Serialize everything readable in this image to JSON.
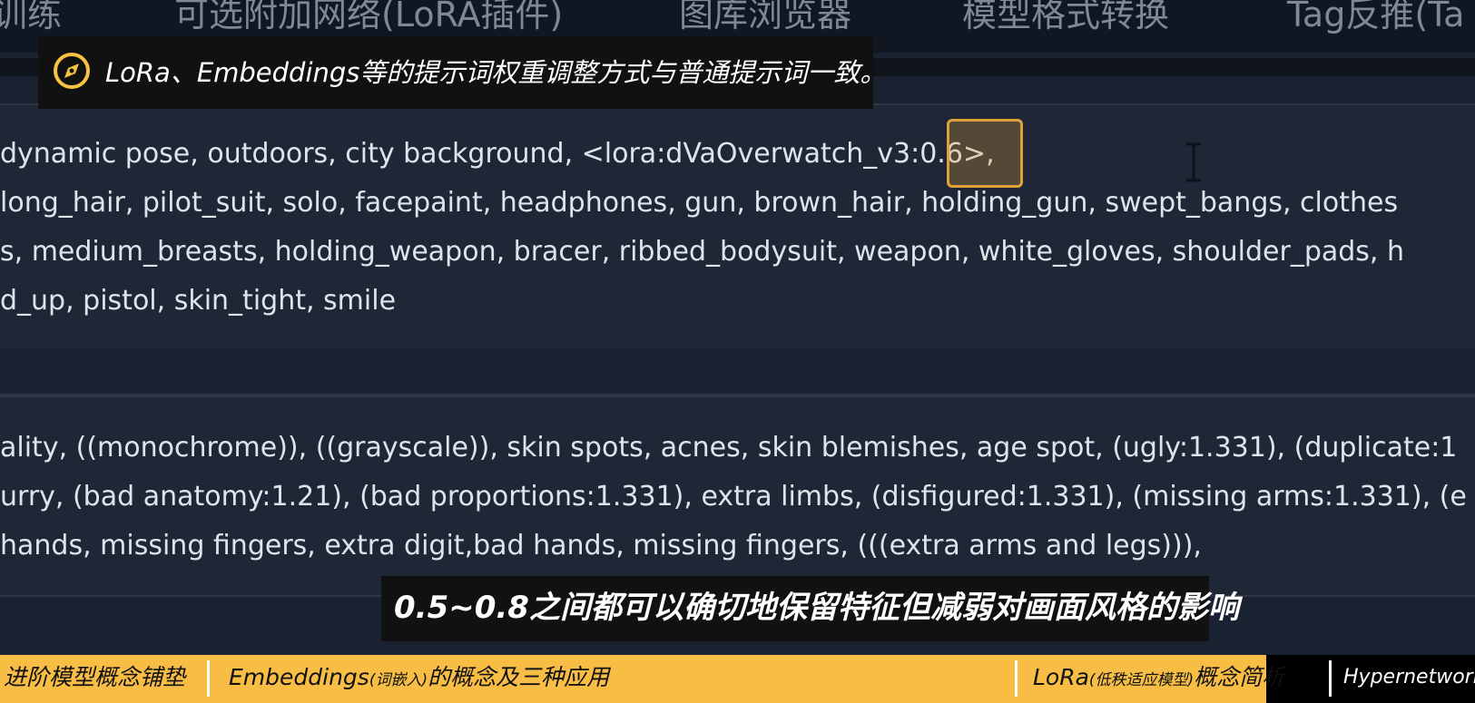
{
  "tabs": [
    {
      "label": "训练"
    },
    {
      "label": "可选附加网络(LoRA插件)"
    },
    {
      "label": "图库浏览器"
    },
    {
      "label": "模型格式转换"
    },
    {
      "label": "Tag反推(Ta"
    }
  ],
  "tip": {
    "icon": "compass-icon",
    "text": "LoRa、Embeddings等的提示词权重调整方式与普通提示词一致。",
    "color": "#f5c242"
  },
  "positive_prompt": {
    "lines": [
      " dynamic pose, outdoors, city background, <lora:dVaOverwatch_v3:0.6>,",
      " long_hair, pilot_suit, solo, facepaint, headphones, gun, brown_hair, holding_gun, swept_bangs, clothes",
      "s, medium_breasts, holding_weapon, bracer, ribbed_bodysuit, weapon, white_gloves, shoulder_pads, h",
      "d_up, pistol, skin_tight, smile"
    ]
  },
  "negative_prompt": {
    "lines": [
      "ality, ((monochrome)), ((grayscale)), skin spots, acnes, skin blemishes, age spot, (ugly:1.331), (duplicate:1",
      "urry, (bad anatomy:1.21), (bad proportions:1.331), extra limbs, (disfigured:1.331), (missing arms:1.331), (e",
      " hands, missing fingers, extra digit,bad hands, missing fingers, (((extra arms and legs))),"
    ]
  },
  "subtitle": "0.5~0.8之间都可以确切地保留特征但减弱对画面风格的影响",
  "chapters": [
    {
      "label": "进阶模型概念铺垫"
    },
    {
      "label": "Embeddings",
      "small": "(词嵌入)",
      "rest": "的概念及三种应用"
    },
    {
      "label": "LoRa",
      "small": "(低秩适应模型)",
      "rest": "概念简析"
    },
    {
      "label": "Hypernetwork (超网"
    }
  ],
  "colors": {
    "chapter_bar": "#f8bd45",
    "highlight": "#e0a03a",
    "background": "#1a2130"
  }
}
